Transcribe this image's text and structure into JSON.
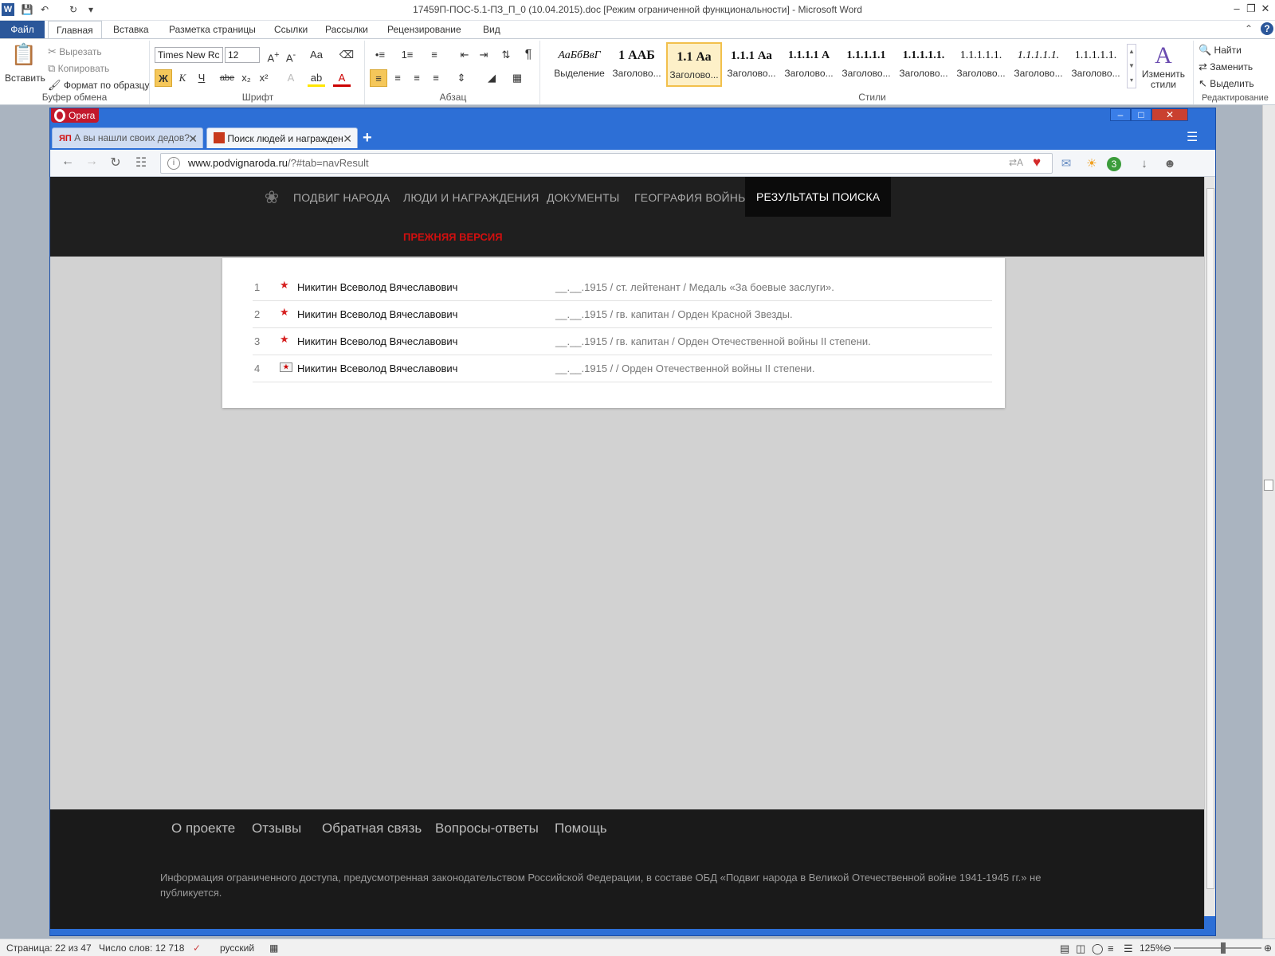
{
  "word": {
    "title": "17459П-ПОС-5.1-ПЗ_П_0 (10.04.2015).doc [Режим ограниченной функциональности]  -  Microsoft Word",
    "tabs": [
      "Файл",
      "Главная",
      "Вставка",
      "Разметка страницы",
      "Ссылки",
      "Рассылки",
      "Рецензирование",
      "Вид"
    ],
    "clipboard": {
      "paste": "Вставить",
      "cut": "Вырезать",
      "copy": "Копировать",
      "format_painter": "Формат по образцу",
      "group_label": "Буфер обмена"
    },
    "font": {
      "family": "Times New Rc",
      "size": "12",
      "bold": "Ж",
      "italic": "К",
      "underline": "Ч",
      "strike": "abe",
      "sub": "x₂",
      "sup": "x²",
      "group_label": "Шрифт"
    },
    "paragraph": {
      "group_label": "Абзац",
      "pilcrow": "¶"
    },
    "styles": {
      "group_label": "Стили",
      "items": [
        {
          "preview": "АаБбВвГ",
          "name": "Выделение"
        },
        {
          "preview": "1  ААБ",
          "name": "Заголово..."
        },
        {
          "preview": "1.1  Аа",
          "name": "Заголово..."
        },
        {
          "preview": "1.1.1  Аа",
          "name": "Заголово..."
        },
        {
          "preview": "1.1.1.1  А",
          "name": "Заголово..."
        },
        {
          "preview": "1.1.1.1.1",
          "name": "Заголово..."
        },
        {
          "preview": "1.1.1.1.1.",
          "name": "Заголово..."
        },
        {
          "preview": "1.1.1.1.1.",
          "name": "Заголово..."
        },
        {
          "preview": "1.1.1.1.1.",
          "name": "Заголово..."
        },
        {
          "preview": "1.1.1.1.1.",
          "name": "Заголово..."
        }
      ],
      "change_styles": "Изменить стили"
    },
    "editing": {
      "find": "Найти",
      "replace": "Заменить",
      "select": "Выделить",
      "group_label": "Редактирование"
    },
    "status": {
      "page": "Страница: 22 из 47",
      "words": "Число слов: 12 718",
      "language": "русский",
      "zoom": "125%"
    }
  },
  "opera": {
    "menu_label": "Opera",
    "tabs": [
      {
        "label": "А вы нашли своих дедов? -"
      },
      {
        "label": "Поиск людей и награжден"
      }
    ],
    "url_domain": "www.podvignaroda.ru",
    "url_rest": "/?#tab=navResult",
    "badge_count": "3"
  },
  "site": {
    "nav": [
      "ПОДВИГ НАРОДА",
      "ЛЮДИ И НАГРАЖДЕНИЯ",
      "ДОКУМЕНТЫ",
      "ГЕОГРАФИЯ ВОЙНЫ",
      "РЕЗУЛЬТАТЫ ПОИСКА"
    ],
    "previous_version": "ПРЕЖНЯЯ ВЕРСИЯ",
    "results": [
      {
        "num": "1",
        "name": "Никитин Всеволод Вячеславович",
        "info": "__.__.1915 /  ст. лейтенант /  Медаль «За боевые заслуги».",
        "icon": "star-icon"
      },
      {
        "num": "2",
        "name": "Никитин Всеволод Вячеславович",
        "info": "__.__.1915 /  гв. капитан /  Орден Красной Звезды.",
        "icon": "star-icon"
      },
      {
        "num": "3",
        "name": "Никитин Всеволод Вячеславович",
        "info": "__.__.1915 /  гв. капитан /  Орден Отечественной войны II степени.",
        "icon": "star-icon"
      },
      {
        "num": "4",
        "name": "Никитин Всеволод Вячеславович",
        "info": "__.__.1915 /   /  Орден Отечественной войны II степени.",
        "icon": "card-file-icon"
      }
    ],
    "footer": {
      "links": [
        "О проекте",
        "Отзывы",
        "Обратная связь",
        "Вопросы-ответы",
        "Помощь"
      ],
      "note": "Информация ограниченного доступа, предусмотренная законодательством Российской Федерации, в составе ОБД «Подвиг народа в Великой Отечественной войне 1941-1945 гг.» не публикуется."
    }
  },
  "colors": {
    "word_blue": "#2b579a",
    "opera_blue": "#2d6fd6",
    "nav_bg": "#1f1f1f",
    "accent_red": "#d20f0f"
  }
}
